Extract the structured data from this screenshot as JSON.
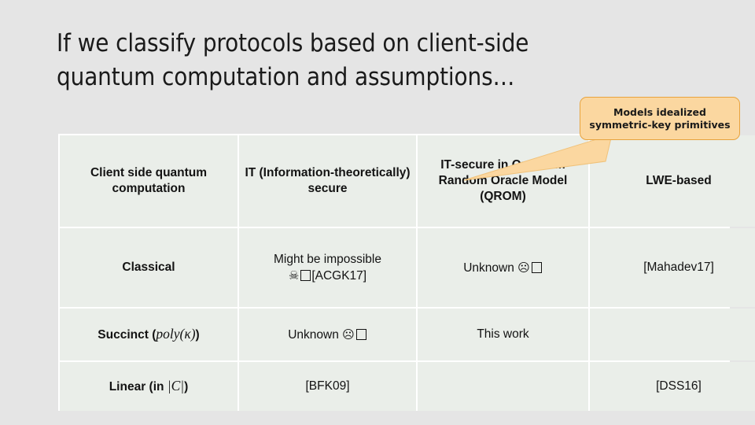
{
  "slide": {
    "title": "If we classify protocols based on client-side\nquantum computation and assumptions…",
    "background_color": "#e5e5e5"
  },
  "callout": {
    "text": "Models idealized\nsymmetric-key primitives",
    "fill_color": "#fbd7a0",
    "border_color": "#e8a33d",
    "points_at": "IT-secure in Quantum Random Oracle Model (QROM)"
  },
  "table": {
    "header_fill": "#70ad47",
    "body_fill": "#eaeee9",
    "highlight_color": "#b01c1c",
    "columns": [
      {
        "label": "Client side quantum computation"
      },
      {
        "label": "IT (Information-theoretically) secure"
      },
      {
        "label": "IT-secure in Quantum Random Oracle Model (QROM)"
      },
      {
        "label": "LWE-based"
      }
    ],
    "rows": [
      {
        "head": "Classical",
        "head_math": "",
        "cells": [
          {
            "text": "Might be impossible",
            "extra": "[ACGK17]",
            "symbol": "☠",
            "tofu": true,
            "highlight": false
          },
          {
            "text": "Unknown",
            "extra": "",
            "symbol": "☹",
            "tofu": true,
            "highlight": false
          },
          {
            "text": "[Mahadev17]",
            "extra": "",
            "symbol": "",
            "tofu": false,
            "highlight": false
          }
        ]
      },
      {
        "head": "Succinct (",
        "head_math": "poly(κ)",
        "head_tail": ")",
        "cells": [
          {
            "text": "Unknown",
            "extra": "",
            "symbol": "☹",
            "tofu": true,
            "highlight": false
          },
          {
            "text": "This work",
            "extra": "",
            "symbol": "",
            "tofu": false,
            "highlight": true
          },
          {
            "text": "",
            "extra": "",
            "symbol": "",
            "tofu": false,
            "highlight": false
          }
        ]
      },
      {
        "head": "Linear (in ",
        "head_math": "|C|",
        "head_tail": ")",
        "cells": [
          {
            "text": "[BFK09]",
            "extra": "",
            "symbol": "",
            "tofu": false,
            "highlight": false
          },
          {
            "text": "",
            "extra": "",
            "symbol": "",
            "tofu": false,
            "highlight": false
          },
          {
            "text": "[DSS16]",
            "extra": "",
            "symbol": "",
            "tofu": false,
            "highlight": false
          }
        ]
      }
    ]
  }
}
